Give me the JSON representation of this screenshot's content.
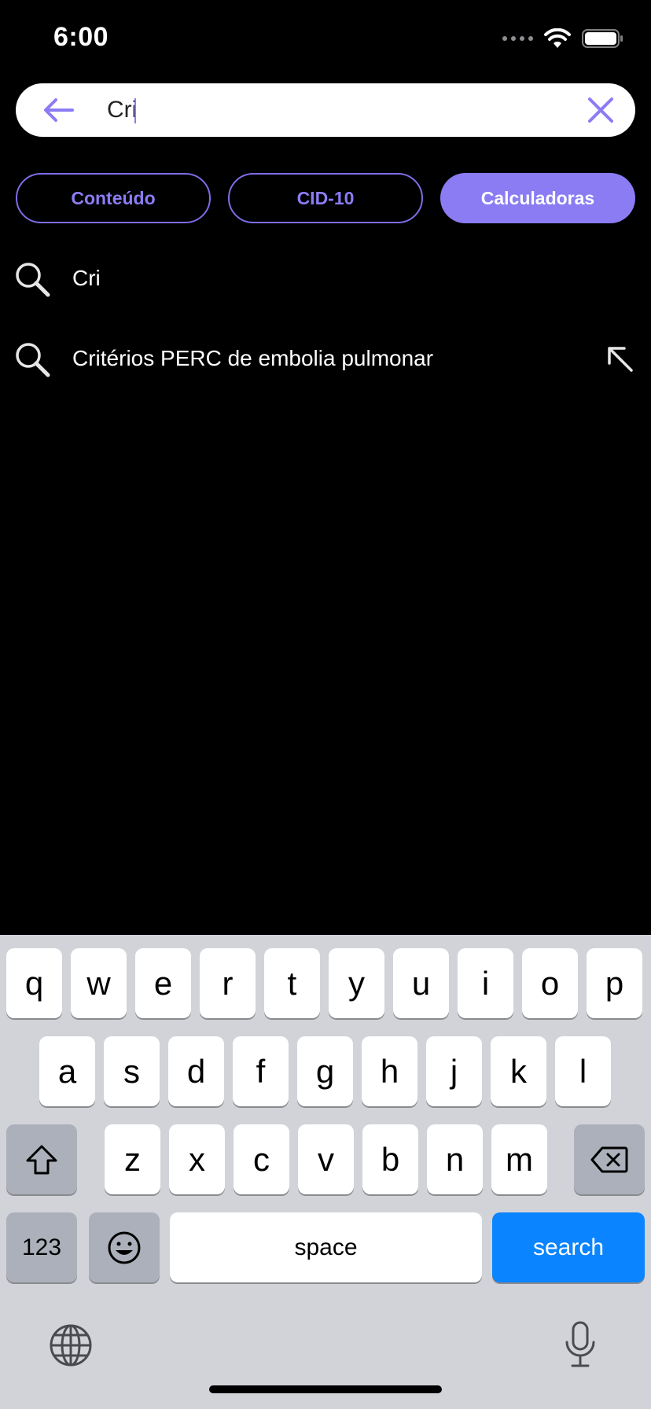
{
  "status_bar": {
    "time": "6:00"
  },
  "search": {
    "query": "Cri"
  },
  "filters": [
    {
      "label": "Conteúdo",
      "selected": false
    },
    {
      "label": "CID-10",
      "selected": false
    },
    {
      "label": "Calculadoras",
      "selected": true
    }
  ],
  "suggestions": [
    {
      "text": "Cri",
      "has_fill_arrow": false
    },
    {
      "text": "Critérios PERC de embolia pulmonar",
      "has_fill_arrow": true
    }
  ],
  "keyboard": {
    "row1": [
      "q",
      "w",
      "e",
      "r",
      "t",
      "y",
      "u",
      "i",
      "o",
      "p"
    ],
    "row2": [
      "a",
      "s",
      "d",
      "f",
      "g",
      "h",
      "j",
      "k",
      "l"
    ],
    "row3": [
      "z",
      "x",
      "c",
      "v",
      "b",
      "n",
      "m"
    ],
    "numbers_label": "123",
    "space_label": "space",
    "search_label": "search"
  },
  "colors": {
    "accent": "#8b7cf4",
    "keyboard_bg": "#d1d3d9",
    "search_key": "#0a84ff"
  }
}
